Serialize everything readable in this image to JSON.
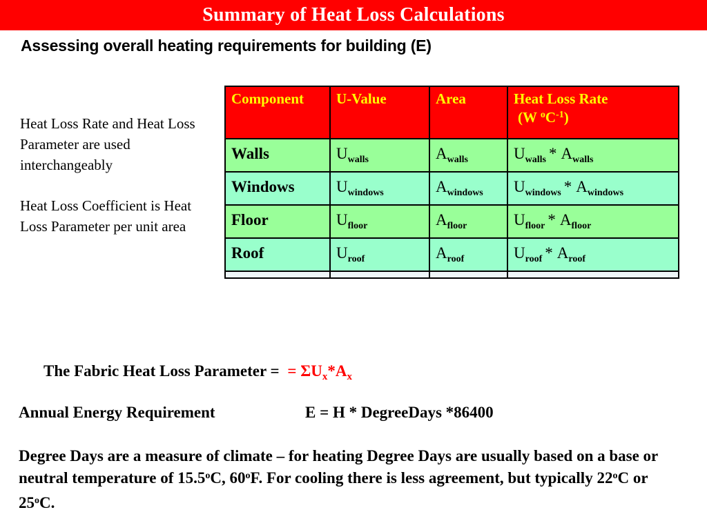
{
  "slide": {
    "title": "Summary of Heat Loss Calculations",
    "subtitle": "Assessing overall heating requirements for building (E)",
    "title_bar_color": "#FF0000",
    "title_text_color": "#FFFFFF",
    "header_text_color": "#FFFF00",
    "accent_red": "#FF0000",
    "row_color_a": "#99FF99",
    "row_color_b": "#99FFCC"
  },
  "notes": [
    "Heat Loss Rate and Heat Loss Parameter are used interchangeably",
    "Heat Loss Coefficient is Heat Loss Parameter per unit area"
  ],
  "table": {
    "headers": [
      {
        "label": "Component",
        "unit": ""
      },
      {
        "label": "U-Value",
        "unit": ""
      },
      {
        "label": "Area",
        "unit": ""
      },
      {
        "label": "Heat Loss Rate",
        "unit_prefix": "(W ",
        "unit_sup_o": "o",
        "unit_mid": "C",
        "unit_sup_exp": "-1",
        "unit_suffix": ")"
      }
    ],
    "rows": [
      {
        "component": "Walls",
        "u_base": "U",
        "u_sub": "walls",
        "a_base": "A",
        "a_sub": "walls",
        "rate_u_base": "U",
        "rate_u_sub": "walls",
        "rate_op": "*",
        "rate_a_base": "A",
        "rate_a_sub": "walls"
      },
      {
        "component": "Windows",
        "u_base": "U",
        "u_sub": "windows",
        "a_base": "A",
        "a_sub": "windows",
        "rate_u_base": "U",
        "rate_u_sub": "windows",
        "rate_op": "*",
        "rate_a_base": "A",
        "rate_a_sub": "windows"
      },
      {
        "component": "Floor",
        "u_base": "U",
        "u_sub": "floor",
        "a_base": "A",
        "a_sub": "floor",
        "rate_u_base": "U",
        "rate_u_sub": "floor",
        "rate_op": "*",
        "rate_a_base": "A",
        "rate_a_sub": "floor"
      },
      {
        "component": "Roof",
        "u_base": "U",
        "u_sub": "roof",
        "a_base": "A",
        "a_sub": "roof",
        "rate_u_base": "U",
        "rate_u_sub": "roof",
        "rate_op": "*",
        "rate_a_base": "A",
        "rate_a_sub": "roof"
      }
    ]
  },
  "equations": {
    "fabric_label": "The Fabric Heat Loss Parameter = ",
    "fabric_formula_prefix": "= ΣU",
    "fabric_formula_sub1": "x",
    "fabric_formula_mid": "*A",
    "fabric_formula_sub2": "x",
    "annual_label": "Annual Energy Requirement",
    "annual_formula": "E = H * DegreeDays *86400"
  },
  "degree_days": {
    "p1": "Degree Days are  a measure of climate – for heating  Degree Days are usually based on a base or neutral temperature of 15.5",
    "sup1": "o",
    "p2": "C, 60",
    "sup2": "o",
    "p3": "F.    For cooling  there is less agreement, but typically 22",
    "sup3": "o",
    "p4": "C or 25",
    "sup4": "o",
    "p5": "C."
  }
}
